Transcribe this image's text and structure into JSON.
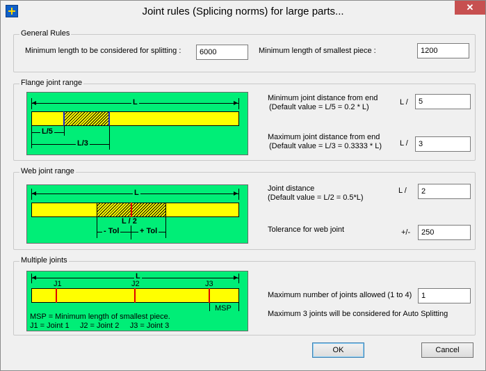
{
  "window": {
    "title": "Joint rules (Splicing norms) for large parts...",
    "close_label": "✕"
  },
  "general": {
    "label": "General Rules",
    "min_split_label": "Minimum length to be considered for splitting :",
    "min_split_value": "6000",
    "min_piece_label": "Minimum length of smallest piece :",
    "min_piece_value": "1200"
  },
  "flange": {
    "label": "Flange joint range",
    "diagram": {
      "L": "L",
      "L5": "L/5",
      "L3": "L/3"
    },
    "min_label_1": "Minimum joint distance from end",
    "min_label_2": "(Default value = L/5 = 0.2 * L)",
    "min_prefix": "L /",
    "min_value": "5",
    "max_label_1": "Maximum joint distance from end",
    "max_label_2": "(Default value = L/3 = 0.3333 * L)",
    "max_prefix": "L /",
    "max_value": "3"
  },
  "web": {
    "label": "Web joint range",
    "diagram": {
      "L": "L",
      "L2": "L / 2",
      "minus_tol": "- Tol",
      "plus_tol": "+ Tol"
    },
    "dist_label_1": "Joint distance",
    "dist_label_2": "(Default value = L/2 = 0.5*L)",
    "dist_prefix": "L /",
    "dist_value": "2",
    "tol_label": "Tolerance for web joint",
    "tol_prefix": "+/-",
    "tol_value": "250"
  },
  "multiple": {
    "label": "Multiple joints",
    "diagram": {
      "L": "L",
      "J1": "J1",
      "J2": "J2",
      "J3": "J3",
      "MSP": "MSP",
      "note": "MSP = Minimum length of smallest piece.",
      "legend": "J1 = Joint 1     J2 = Joint 2     J3 = Joint 3"
    },
    "max_joints_label": "Maximum number of joints allowed (1 to 4)",
    "max_joints_value": "1",
    "auto_note": "Maximum 3 joints will be considered for Auto Splitting"
  },
  "buttons": {
    "ok": "OK",
    "cancel": "Cancel"
  },
  "colors": {
    "diagram_bg": "#00ee77",
    "bar": "#ffff00",
    "joint": "#e00000"
  }
}
